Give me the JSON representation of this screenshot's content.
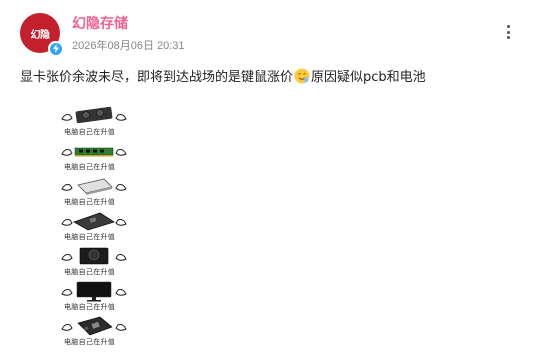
{
  "author": {
    "name": "幻隐存储",
    "avatar_text": "幻隐",
    "verified": true
  },
  "post": {
    "time": "2026年08月06日 20:31",
    "text_before": "显卡张价余波未尽，即将到达战场的是键鼠涨价",
    "emoji": "face-emoji",
    "text_after": "原因疑似pcb和电池"
  },
  "meme": {
    "rows": [
      {
        "caption": "电脑自己在升值",
        "item": "graphics-card"
      },
      {
        "caption": "电脑自己在升值",
        "item": "memory-stick"
      },
      {
        "caption": "电脑自己在升值",
        "item": "ssd-drive"
      },
      {
        "caption": "电脑自己在升值",
        "item": "motherboard"
      },
      {
        "caption": "电脑自己在升值",
        "item": "power-supply"
      },
      {
        "caption": "电脑自己在升值",
        "item": "monitor"
      },
      {
        "caption": "电脑自己在升值",
        "item": "motherboard-board"
      }
    ]
  },
  "colors": {
    "author": "#f06292",
    "avatar_bg": "#c41f2c",
    "verified": "#2fa6f5"
  }
}
